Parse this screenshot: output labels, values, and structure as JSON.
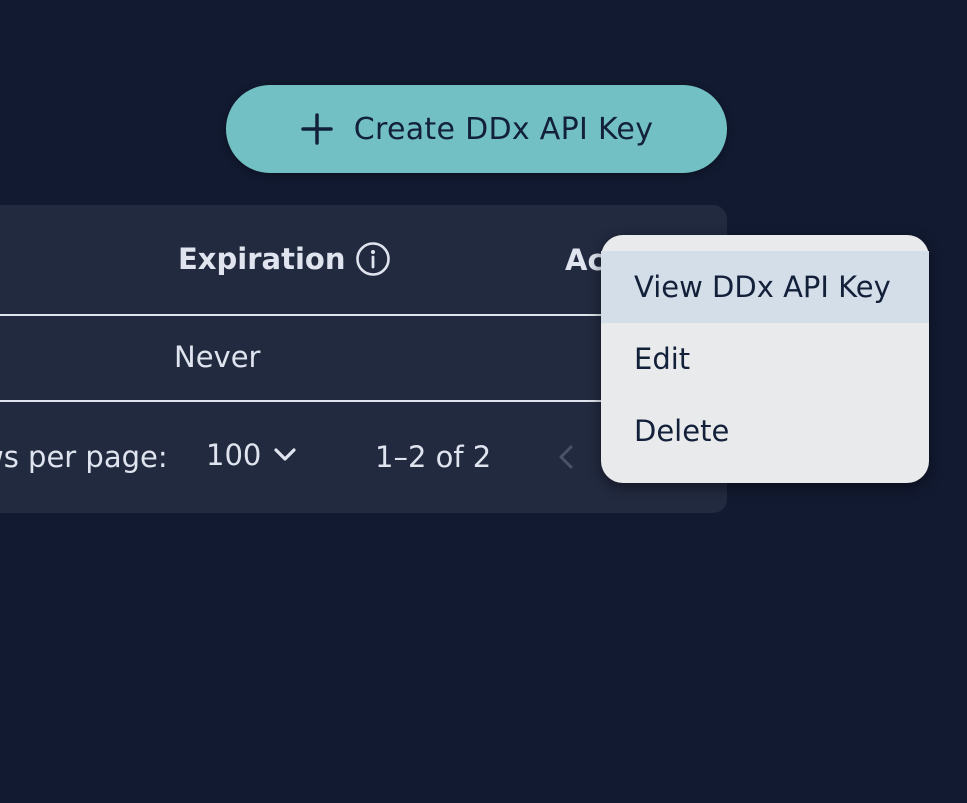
{
  "toolbar": {
    "create_label": "Create DDx API Key",
    "create_icon": "plus-icon"
  },
  "table": {
    "columns": {
      "expiration": "Expiration",
      "expiration_icon": "info-icon",
      "actions": "Ac"
    },
    "rows": [
      {
        "expiration": "Never"
      }
    ]
  },
  "pagination": {
    "rows_per_page_label": "ws per page:",
    "rows_per_page_value": "100",
    "range": "1–2 of 2"
  },
  "menu": {
    "items": [
      {
        "label": "View DDx API Key",
        "selected": true
      },
      {
        "label": "Edit",
        "selected": false
      },
      {
        "label": "Delete",
        "selected": false
      }
    ]
  },
  "colors": {
    "background": "#121a31",
    "card": "#222a40",
    "accent": "#72c0c3",
    "menu_bg": "#e9eaec",
    "menu_selected": "#d4dee9"
  }
}
